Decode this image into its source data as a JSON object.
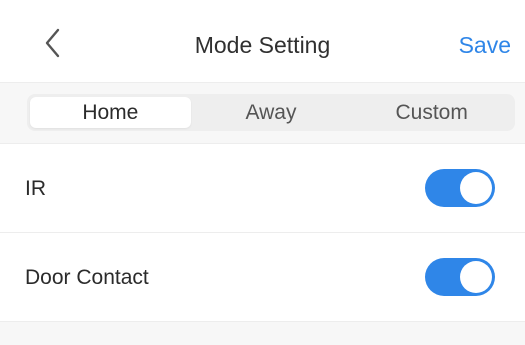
{
  "header": {
    "title": "Mode Setting",
    "save_label": "Save",
    "back_icon": "chevron-left-icon"
  },
  "mode_tabs": {
    "items": [
      {
        "label": "Home",
        "selected": true
      },
      {
        "label": "Away",
        "selected": false
      },
      {
        "label": "Custom",
        "selected": false
      }
    ]
  },
  "settings": [
    {
      "label": "IR",
      "enabled": true
    },
    {
      "label": "Door Contact",
      "enabled": true
    }
  ],
  "colors": {
    "accent": "#2f86e8",
    "background": "#f7f7f7"
  }
}
